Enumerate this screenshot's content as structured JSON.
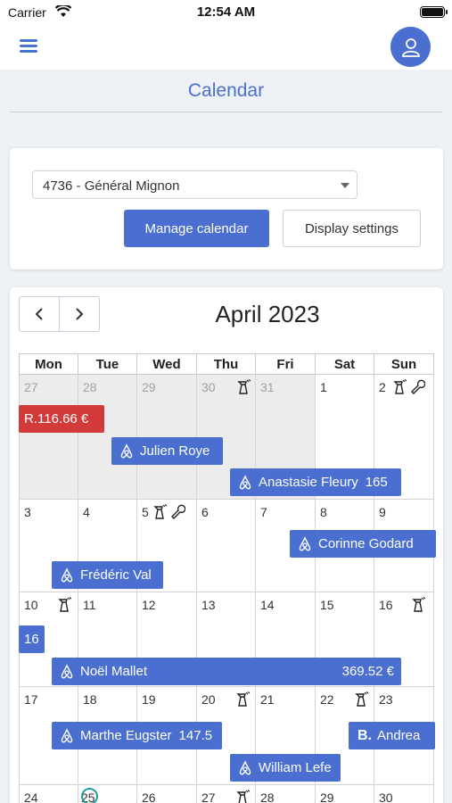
{
  "status_bar": {
    "carrier": "Carrier",
    "time": "12:54 AM"
  },
  "header": {
    "title": "Calendar",
    "menu_icon": "hamburger-menu-icon",
    "avatar_icon": "user-icon"
  },
  "controls": {
    "property_value": "4736 - Général Mignon",
    "manage_label": "Manage calendar",
    "display_label": "Display settings"
  },
  "calendar": {
    "month_label": "April 2023",
    "prev_icon": "chevron-left-icon",
    "next_icon": "chevron-right-icon",
    "weekdays": [
      "Mon",
      "Tue",
      "Wed",
      "Thu",
      "Fri",
      "Sat",
      "Sun"
    ],
    "weeks": [
      [
        "27",
        "28",
        "29",
        "30",
        "31",
        "1",
        "2"
      ],
      [
        "3",
        "4",
        "5",
        "6",
        "7",
        "8",
        "9"
      ],
      [
        "10",
        "11",
        "12",
        "13",
        "14",
        "15",
        "16"
      ],
      [
        "17",
        "18",
        "19",
        "20",
        "21",
        "22",
        "23"
      ],
      [
        "24",
        "25",
        "26",
        "27",
        "28",
        "29",
        "30"
      ]
    ],
    "today": "25",
    "events": [
      {
        "name": "R.116.66 €",
        "amount": "",
        "source": "other"
      },
      {
        "name": "Julien Roye",
        "amount": "",
        "source": "airbnb"
      },
      {
        "name": "Anastasie Fleury",
        "amount": "165",
        "source": "airbnb"
      },
      {
        "name": "Corinne Godard",
        "amount": "",
        "source": "airbnb"
      },
      {
        "name": "Frédéric Val",
        "amount": "",
        "source": "airbnb"
      },
      {
        "name": "16",
        "amount": "",
        "source": "airbnb"
      },
      {
        "name": "Noël Mallet",
        "amount": "369.52 €",
        "source": "airbnb"
      },
      {
        "name": "Marthe Eugster",
        "amount": "147.5",
        "source": "airbnb"
      },
      {
        "name": "Andrea",
        "amount": "",
        "source": "booking",
        "mark": "B."
      },
      {
        "name": "William Lefe",
        "amount": "",
        "source": "airbnb"
      }
    ],
    "colors": {
      "primary": "#4a6fd0",
      "alert": "#d33b3b",
      "today_ring": "#1f9d96",
      "other_month": "#ececec"
    }
  }
}
